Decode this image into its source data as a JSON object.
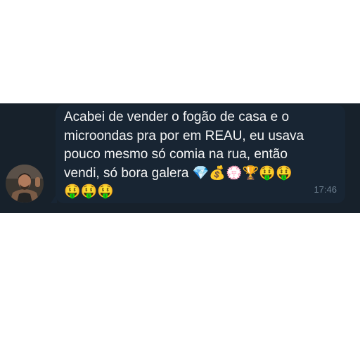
{
  "message": {
    "text": "Acabei de vender o fogão de casa e o\nmicroondas pra por em REAU, eu usava\npouco mesmo só comia na rua, então\nvendi, só bora galera 💎💰💮🏆🤑🤑\n🤑🤑🤑",
    "time": "17:46",
    "sender_avatar": "user-avatar-photo"
  },
  "colors": {
    "chat_background": "#17212b",
    "bubble": "#182533",
    "text": "#f5f5f5",
    "timestamp": "#6d7f8f"
  }
}
